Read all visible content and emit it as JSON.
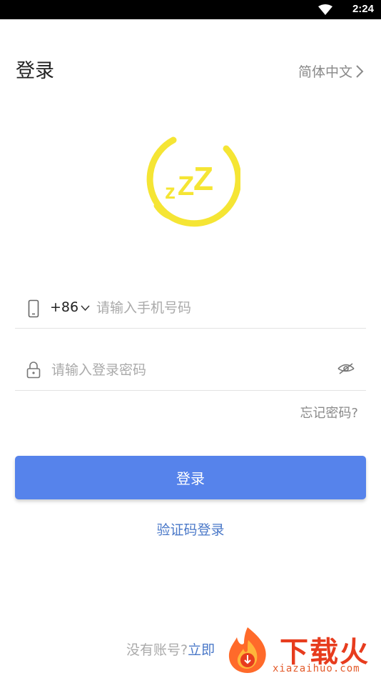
{
  "status_bar": {
    "time": "2:24"
  },
  "header": {
    "title": "登录",
    "language": "简体中文"
  },
  "phone": {
    "country_code": "+86",
    "placeholder": "请输入手机号码"
  },
  "password": {
    "placeholder": "请输入登录密码"
  },
  "forgot_password": "忘记密码?",
  "login_button": "登录",
  "code_login": "验证码登录",
  "register": {
    "prompt": "没有账号?",
    "link": "立即"
  },
  "watermark": {
    "title": "下载火",
    "domain": "xiazaihuo.com"
  },
  "colors": {
    "primary": "#5683eb",
    "link": "#4a78c8",
    "logo": "#f5e534",
    "watermark": "#e73c1e"
  },
  "icons": [
    "wifi-icon",
    "chevron-right-icon",
    "sleep-logo-icon",
    "phone-icon",
    "chevron-down-icon",
    "lock-icon",
    "eye-off-icon",
    "flame-icon"
  ]
}
